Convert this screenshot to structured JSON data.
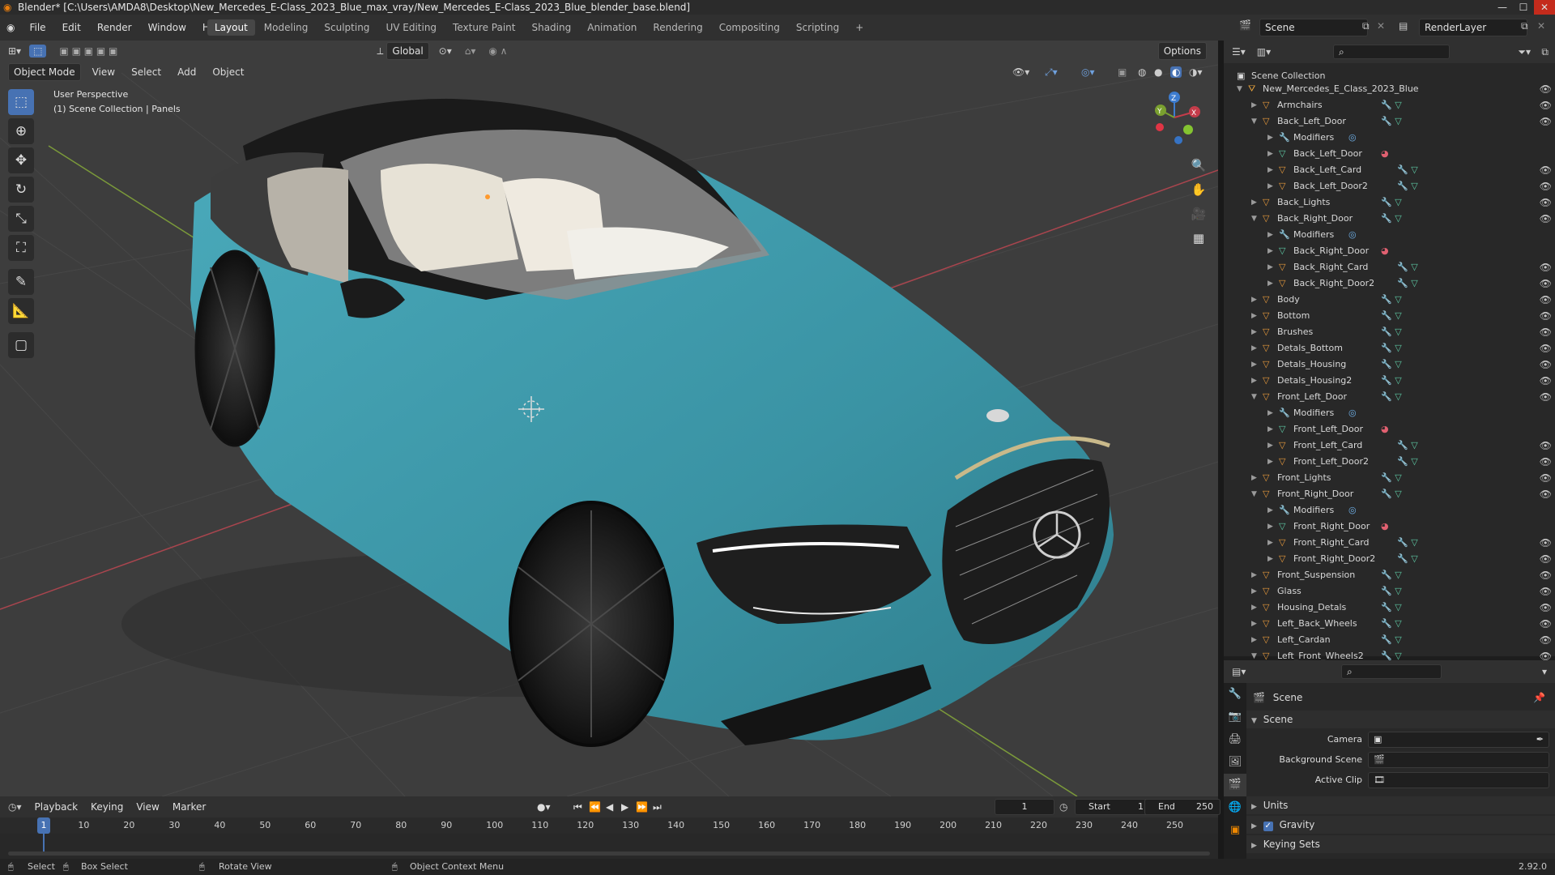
{
  "title_bar": {
    "title": "Blender* [C:\\Users\\AMDA8\\Desktop\\New_Mercedes_E-Class_2023_Blue_max_vray/New_Mercedes_E-Class_2023_Blue_blender_base.blend]"
  },
  "menu": [
    "File",
    "Edit",
    "Render",
    "Window",
    "Help"
  ],
  "workspaces": [
    "Layout",
    "Modeling",
    "Sculpting",
    "UV Editing",
    "Texture Paint",
    "Shading",
    "Animation",
    "Rendering",
    "Compositing",
    "Scripting"
  ],
  "workspace_add": "+",
  "scene_field": "Scene",
  "renderlayer_field": "RenderLayer",
  "viewport": {
    "mode": "Object Mode",
    "menus": [
      "View",
      "Select",
      "Add",
      "Object"
    ],
    "transform_orientation": "Global",
    "options": "Options",
    "overlay_title": "User Perspective",
    "overlay_sub": "(1) Scene Collection | Panels",
    "axes": {
      "x": "X",
      "y": "Y",
      "z": "Z"
    }
  },
  "outliner": {
    "root": "Scene Collection",
    "collection": "New_Mercedes_E_Class_2023_Blue",
    "items": [
      {
        "name": "Armchairs",
        "level": 1,
        "expanded": false,
        "kind": "obj"
      },
      {
        "name": "Back_Left_Door",
        "level": 1,
        "expanded": true,
        "kind": "obj"
      },
      {
        "name": "Modifiers",
        "level": 2,
        "expanded": false,
        "kind": "mod"
      },
      {
        "name": "Back_Left_Door",
        "level": 2,
        "expanded": false,
        "kind": "mesh"
      },
      {
        "name": "Back_Left_Card",
        "level": 2,
        "expanded": false,
        "kind": "obj"
      },
      {
        "name": "Back_Left_Door2",
        "level": 2,
        "expanded": false,
        "kind": "obj"
      },
      {
        "name": "Back_Lights",
        "level": 1,
        "expanded": false,
        "kind": "obj"
      },
      {
        "name": "Back_Right_Door",
        "level": 1,
        "expanded": true,
        "kind": "obj"
      },
      {
        "name": "Modifiers",
        "level": 2,
        "expanded": false,
        "kind": "mod"
      },
      {
        "name": "Back_Right_Door",
        "level": 2,
        "expanded": false,
        "kind": "mesh"
      },
      {
        "name": "Back_Right_Card",
        "level": 2,
        "expanded": false,
        "kind": "obj"
      },
      {
        "name": "Back_Right_Door2",
        "level": 2,
        "expanded": false,
        "kind": "obj"
      },
      {
        "name": "Body",
        "level": 1,
        "expanded": false,
        "kind": "obj"
      },
      {
        "name": "Bottom",
        "level": 1,
        "expanded": false,
        "kind": "obj"
      },
      {
        "name": "Brushes",
        "level": 1,
        "expanded": false,
        "kind": "obj"
      },
      {
        "name": "Detals_Bottom",
        "level": 1,
        "expanded": false,
        "kind": "obj"
      },
      {
        "name": "Detals_Housing",
        "level": 1,
        "expanded": false,
        "kind": "obj"
      },
      {
        "name": "Detals_Housing2",
        "level": 1,
        "expanded": false,
        "kind": "obj"
      },
      {
        "name": "Front_Left_Door",
        "level": 1,
        "expanded": true,
        "kind": "obj"
      },
      {
        "name": "Modifiers",
        "level": 2,
        "expanded": false,
        "kind": "mod"
      },
      {
        "name": "Front_Left_Door",
        "level": 2,
        "expanded": false,
        "kind": "mesh"
      },
      {
        "name": "Front_Left_Card",
        "level": 2,
        "expanded": false,
        "kind": "obj"
      },
      {
        "name": "Front_Left_Door2",
        "level": 2,
        "expanded": false,
        "kind": "obj"
      },
      {
        "name": "Front_Lights",
        "level": 1,
        "expanded": false,
        "kind": "obj"
      },
      {
        "name": "Front_Right_Door",
        "level": 1,
        "expanded": true,
        "kind": "obj"
      },
      {
        "name": "Modifiers",
        "level": 2,
        "expanded": false,
        "kind": "mod"
      },
      {
        "name": "Front_Right_Door",
        "level": 2,
        "expanded": false,
        "kind": "mesh"
      },
      {
        "name": "Front_Right_Card",
        "level": 2,
        "expanded": false,
        "kind": "obj"
      },
      {
        "name": "Front_Right_Door2",
        "level": 2,
        "expanded": false,
        "kind": "obj"
      },
      {
        "name": "Front_Suspension",
        "level": 1,
        "expanded": false,
        "kind": "obj"
      },
      {
        "name": "Glass",
        "level": 1,
        "expanded": false,
        "kind": "obj"
      },
      {
        "name": "Housing_Detals",
        "level": 1,
        "expanded": false,
        "kind": "obj"
      },
      {
        "name": "Left_Back_Wheels",
        "level": 1,
        "expanded": false,
        "kind": "obj"
      },
      {
        "name": "Left_Cardan",
        "level": 1,
        "expanded": false,
        "kind": "obj"
      },
      {
        "name": "Left_Front_Wheels2",
        "level": 1,
        "expanded": true,
        "kind": "obj"
      }
    ]
  },
  "properties": {
    "header": "Scene",
    "panel": "Scene",
    "fields": [
      {
        "label": "Camera",
        "value": ""
      },
      {
        "label": "Background Scene",
        "value": ""
      },
      {
        "label": "Active Clip",
        "value": ""
      }
    ],
    "subpanels": [
      "Units",
      "Gravity",
      "Keying Sets"
    ],
    "gravity_checked": true
  },
  "timeline": {
    "menus": [
      "Playback",
      "Keying",
      "View",
      "Marker"
    ],
    "current_frame": "1",
    "start_label": "Start",
    "start": "1",
    "end_label": "End",
    "end": "250",
    "ticks": [
      "10",
      "20",
      "30",
      "40",
      "50",
      "60",
      "70",
      "80",
      "90",
      "100",
      "110",
      "120",
      "130",
      "140",
      "150",
      "160",
      "170",
      "180",
      "190",
      "200",
      "210",
      "220",
      "230",
      "240",
      "250"
    ],
    "playhead": "1"
  },
  "statusbar": {
    "select": "Select",
    "box_select": "Box Select",
    "rotate": "Rotate View",
    "context": "Object Context Menu",
    "version": "2.92.0"
  },
  "colors": {
    "accent": "#4772b3",
    "car": "#3a93a4",
    "grid": "#4a4a4a",
    "axis_x": "#b04a52",
    "axis_y": "#7a9a3a"
  }
}
